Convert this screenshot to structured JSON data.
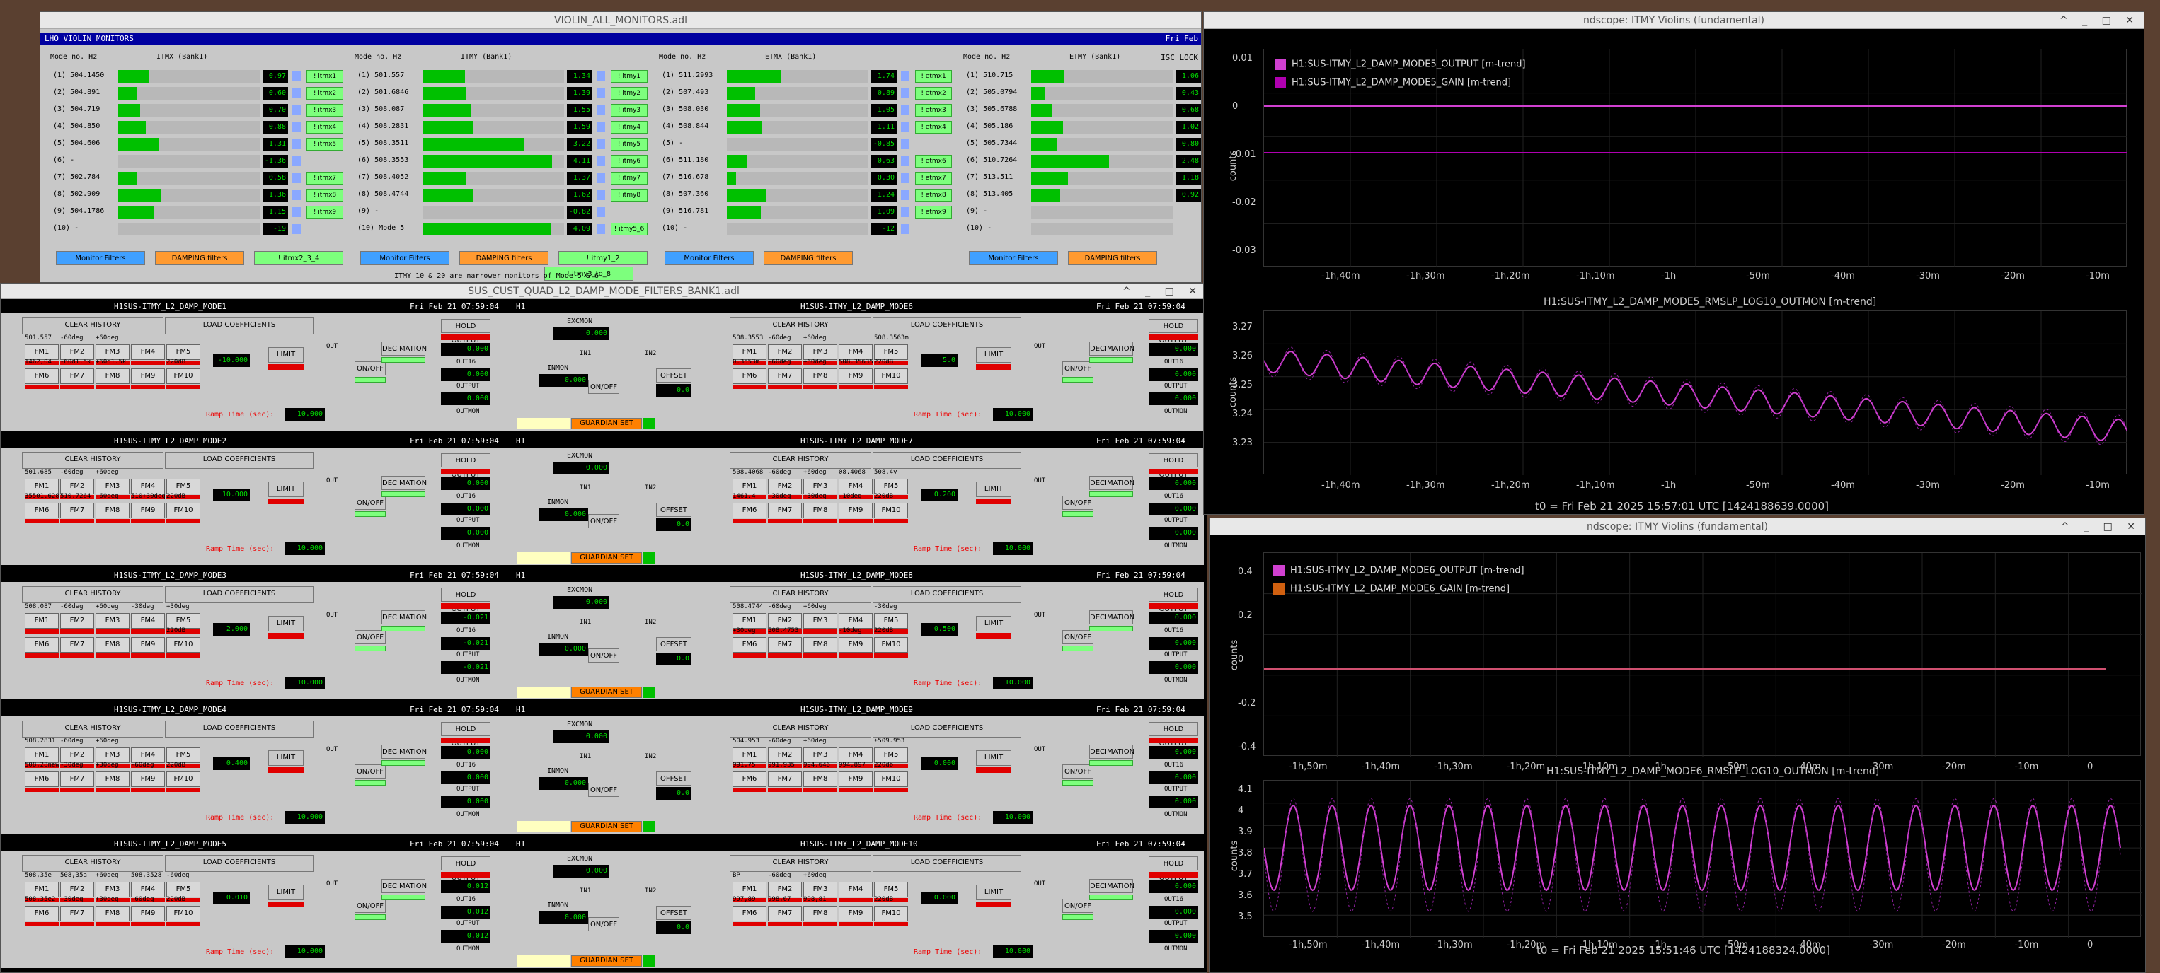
{
  "monitors": {
    "title": "VIOLIN_ALL_MONITORS.adl",
    "header": "LHO VIOLIN MONITORS",
    "date": "Fri Feb",
    "isc_lock": "ISC_LOCK",
    "note": "ITMY 10 & 20 are narrower monitors of Mode 5 & 6",
    "colhdr": "Mode no.  Hz",
    "groups": [
      {
        "name": "ITMX (Bank1)",
        "rows": [
          [
            "(1) 504.1450",
            "0.97",
            "! itmx1"
          ],
          [
            "(2) 504.891",
            "0.60",
            "! itmx2"
          ],
          [
            "(3) 504.719",
            "0.70",
            "! itmx3"
          ],
          [
            "(4) 504.850",
            "0.88",
            "! itmx4"
          ],
          [
            "(5) 504.606",
            "1.31",
            "! itmx5"
          ],
          [
            "(6) -",
            "-1.36",
            ""
          ],
          [
            "(7) 502.784",
            "0.58",
            "! itmx7"
          ],
          [
            "(8) 502.909",
            "1.36",
            "! itmx8"
          ],
          [
            "(9) 504.1786",
            "1.15",
            "! itmx9"
          ],
          [
            "(10) -",
            "-19",
            ""
          ]
        ],
        "buttons": [
          "Monitor Filters",
          "DAMPING filters",
          "! itmx2_3_4"
        ]
      },
      {
        "name": "ITMY (Bank1)",
        "rows": [
          [
            "(1) 501.557",
            "1.34",
            "! itmy1"
          ],
          [
            "(2) 501.6846",
            "1.39",
            "! itmy2"
          ],
          [
            "(3) 508.087",
            "1.55",
            "! itmy3"
          ],
          [
            "(4) 508.2831",
            "1.59",
            "! itmy4"
          ],
          [
            "(5) 508.3511",
            "3.22",
            "! itmy5"
          ],
          [
            "(6) 508.3553",
            "4.11",
            "! itmy6"
          ],
          [
            "(7) 508.4052",
            "1.37",
            "! itmy7"
          ],
          [
            "(8) 508.4744",
            "1.62",
            "! itmy8"
          ],
          [
            "(9) -",
            "-0.82",
            ""
          ],
          [
            "(10) Mode 5",
            "4.09",
            "! itmy5_6"
          ]
        ],
        "buttons": [
          "Monitor Filters",
          "DAMPING filters",
          "! itmy1_2",
          "! itmy3_to_8"
        ]
      },
      {
        "name": "ETMX (Bank1)",
        "rows": [
          [
            "(1) 511.2993",
            "1.74",
            "! etmx1"
          ],
          [
            "(2) 507.493",
            "0.89",
            "! etmx2"
          ],
          [
            "(3) 508.030",
            "1.05",
            "! etmx3"
          ],
          [
            "(4) 508.844",
            "1.11",
            "! etmx4"
          ],
          [
            "(5) -",
            "-0.85",
            ""
          ],
          [
            "(6) 511.180",
            "0.63",
            "! etmx6"
          ],
          [
            "(7) 516.678",
            "0.30",
            "! etmx7"
          ],
          [
            "(8) 507.360",
            "1.24",
            "! etmx8"
          ],
          [
            "(9) 516.781",
            "1.09",
            "! etmx9"
          ],
          [
            "(10) -",
            "-12",
            ""
          ]
        ],
        "buttons": [
          "Monitor Filters",
          "DAMPING filters"
        ]
      },
      {
        "name": "ETMY (Bank1)",
        "rows": [
          [
            "(1) 510.715",
            "1.06",
            ""
          ],
          [
            "(2) 505.0794",
            "0.43",
            ""
          ],
          [
            "(3) 505.6788",
            "0.68",
            ""
          ],
          [
            "(4) 505.186",
            "1.02",
            ""
          ],
          [
            "(5) 505.7344",
            "0.80",
            ""
          ],
          [
            "(6) 510.7264",
            "2.48",
            ""
          ],
          [
            "(7) 513.511",
            "1.18",
            ""
          ],
          [
            "(8) 513.405",
            "0.92",
            ""
          ],
          [
            "(9) -",
            "",
            ""
          ],
          [
            "(10) -",
            "",
            ""
          ]
        ],
        "buttons": [
          "Monitor Filters",
          "DAMPING filters"
        ]
      }
    ]
  },
  "damp": {
    "title": "SUS_CUST_QUAD_L2_DAMP_MODE_FILTERS_BANK1.adl",
    "date": "Fri Feb 21 07:59:04",
    "labels": {
      "clear": "CLEAR HISTORY",
      "load": "LOAD COEFFICIENTS",
      "hold": "HOLD OUTPUT",
      "limit": "LIMIT",
      "onoff": "ON/OFF",
      "decim": "DECIMATION",
      "out": "OUT",
      "out16": "OUT16",
      "output": "OUTPUT",
      "outmon": "OUTMON",
      "inmon": "INMON",
      "in1": "IN1",
      "in2": "IN2",
      "offset": "OFFSET",
      "excmon": "EXCMON",
      "ramp": "Ramp Time (sec):",
      "guardian": "GUARDIAN SET",
      "h1": "H1"
    },
    "filters": [
      "FM1",
      "FM2",
      "FM3",
      "FM4",
      "FM5",
      "FM6",
      "FM7",
      "FM8",
      "FM9",
      "FM10"
    ],
    "modes": [
      {
        "left": "H1SUS-ITMY_L2_DAMP_MODE1",
        "right": "H1SUS-ITMY_L2_DAMP_MODE6",
        "lf": [
          "501,557",
          "-60deg",
          "+60deg",
          "",
          "",
          "1462,04",
          "-60d1.5k",
          "+60d1.5k",
          "",
          "220dB"
        ],
        "rf": [
          "508.3553",
          "-60deg",
          "+60deg",
          "",
          "508.3563m",
          "0.3553m",
          "-60deg",
          "+60deg",
          "508.35635",
          "220dB"
        ],
        "lgain": "-10.000",
        "rgain": "5.0",
        "lout": "0.000",
        "rout": "0.000",
        "ramp": "10.000"
      },
      {
        "left": "H1SUS-ITMY_L2_DAMP_MODE2",
        "right": "H1SUS-ITMY_L2_DAMP_MODE7",
        "lf": [
          "501,685",
          "-60deg",
          "+60deg",
          "",
          "",
          "35501.628",
          "510.7264",
          "-60deg",
          "510+30deg",
          "220dB"
        ],
        "rf": [
          "508.4068",
          "-60deg",
          "+60deg",
          "08.4068",
          "508.4v",
          "1461.4",
          "-30deg",
          "+30deg",
          "-10deg",
          "220dB"
        ],
        "lgain": "10.000",
        "rgain": "0.200",
        "lout": "0.000",
        "rout": "0.000",
        "ramp": "10.000"
      },
      {
        "left": "H1SUS-ITMY_L2_DAMP_MODE3",
        "right": "H1SUS-ITMY_L2_DAMP_MODE8",
        "lf": [
          "508,087",
          "-60deg",
          "+60deg",
          "-30deg",
          "+30deg",
          "",
          "",
          "",
          "",
          "220dB"
        ],
        "rf": [
          "508.4744",
          "-60deg",
          "+60deg",
          "",
          "-30deg",
          "+30deg",
          "508.4753",
          "",
          "-10deg",
          "220dB"
        ],
        "lgain": "2.000",
        "rgain": "0.500",
        "lout": "-0.021",
        "rout": "0.000",
        "ramp": "10.000"
      },
      {
        "left": "H1SUS-ITMY_L2_DAMP_MODE4",
        "right": "H1SUS-ITMY_L2_DAMP_MODE9",
        "lf": [
          "508,2831",
          "-60deg",
          "+60deg",
          "",
          "",
          "508,28new",
          "-30deg",
          "+30deg",
          "-60deg",
          "220dB"
        ],
        "rf": [
          "504.953",
          "-60deg",
          "+60deg",
          "",
          "±509.953",
          "991,75",
          "991,935",
          "994,646",
          "994,897",
          "220db"
        ],
        "lgain": "0.400",
        "rgain": "0.000",
        "lout": "0.000",
        "rout": "0.000",
        "ramp": "10.000"
      },
      {
        "left": "H1SUS-ITMY_L2_DAMP_MODE5",
        "right": "H1SUS-ITMY_L2_DAMP_MODE10",
        "lf": [
          "508,35e",
          "508,35a",
          "+60deg",
          "508,3528",
          "-60deg",
          "508,35e2",
          "-30deg",
          "+30deg",
          "-60deg",
          "220dB"
        ],
        "rf": [
          "BP",
          "-60deg",
          "+60deg",
          "",
          "",
          "997,89",
          "998,67",
          "998,81",
          "",
          "220dB"
        ],
        "lgain": "0.010",
        "rgain": "0.000",
        "lout": "0.012",
        "rout": "0.000",
        "ramp": "10.000"
      }
    ]
  },
  "scope1": {
    "title": "ndscope: ITMY Violins (fundamental)",
    "legend": [
      "H1:SUS-ITMY_L2_DAMP_MODE5_OUTPUT [m-trend]",
      "H1:SUS-ITMY_L2_DAMP_MODE5_GAIN [m-trend]"
    ],
    "yticks": [
      "0.01",
      "0",
      "-0.01",
      "-0.02",
      "-0.03"
    ],
    "xticks": [
      "-1h,40m",
      "-1h,30m",
      "-1h,20m",
      "-1h,10m",
      "-1h",
      "-50m",
      "-40m",
      "-30m",
      "-20m",
      "-10m"
    ],
    "ylabel": "counts",
    "title2": "H1:SUS-ITMY_L2_DAMP_MODE5_RMSLP_LOG10_OUTMON [m-trend]",
    "yticks2": [
      "3.27",
      "3.26",
      "3.25",
      "3.24",
      "3.23"
    ],
    "t0": "t0 = Fri Feb 21 2025 15:57:01 UTC [1424188639.0000]",
    "colors": [
      "#d040d0",
      "#b000b0"
    ]
  },
  "scope2": {
    "title": "ndscope: ITMY Violins (fundamental)",
    "legend": [
      "H1:SUS-ITMY_L2_DAMP_MODE6_OUTPUT [m-trend]",
      "H1:SUS-ITMY_L2_DAMP_MODE6_GAIN [m-trend]"
    ],
    "yticks": [
      "0.4",
      "0.2",
      "0",
      "-0.2",
      "-0.4"
    ],
    "xticks": [
      "-1h,50m",
      "-1h,40m",
      "-1h,30m",
      "-1h,20m",
      "-1h,10m",
      "-1h",
      "-50m",
      "-40m",
      "-30m",
      "-20m",
      "-10m",
      "0"
    ],
    "ylabel": "counts",
    "title2": "H1:SUS-ITMY_L2_DAMP_MODE6_RMSLP_LOG10_OUTMON [m-trend]",
    "yticks2": [
      "4.1",
      "4",
      "3.9",
      "3.8",
      "3.7",
      "3.6",
      "3.5"
    ],
    "t0": "t0 = Fri Feb 21 2025 15:51:46 UTC [1424188324.0000]",
    "colors": [
      "#d040d0",
      "#d06010"
    ]
  }
}
